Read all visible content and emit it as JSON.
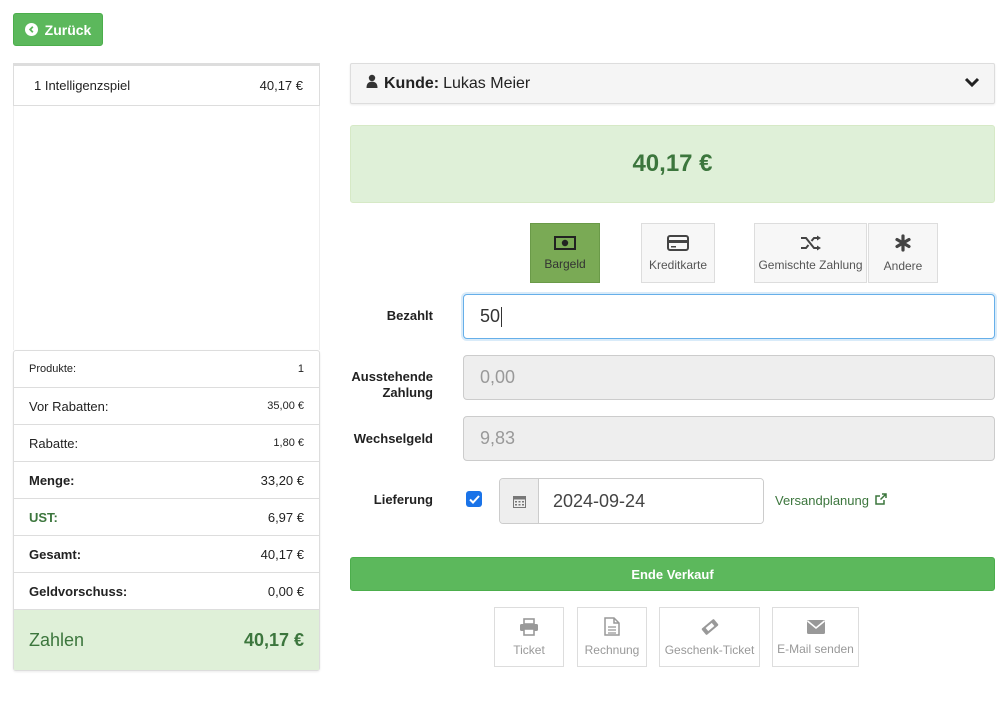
{
  "back": {
    "label": "Zurück"
  },
  "cart": {
    "items": [
      {
        "label": "1 Intelligenzspiel",
        "price": "40,17 €"
      }
    ]
  },
  "totals": {
    "produkte": {
      "label": "Produkte:",
      "value": "1"
    },
    "vor_rabatten": {
      "label": "Vor Rabatten:",
      "value": "35,00 €"
    },
    "rabatte": {
      "label": "Rabatte:",
      "value": "1,80 €"
    },
    "menge": {
      "label": "Menge:",
      "value": "33,20 €"
    },
    "ust": {
      "label": "UST:",
      "value": "6,97 €"
    },
    "gesamt": {
      "label": "Gesamt:",
      "value": "40,17 €"
    },
    "geldvorschuss": {
      "label": "Geldvorschuss:",
      "value": "0,00 €"
    },
    "zahlen": {
      "label": "Zahlen",
      "value": "40,17 €"
    }
  },
  "customer": {
    "key": "Kunde:",
    "name": "Lukas Meier"
  },
  "amount": "40,17 €",
  "methods": [
    {
      "label": "Bargeld",
      "icon": "money-icon",
      "active": true
    },
    {
      "label": "Kreditkarte",
      "icon": "credit-card-icon",
      "active": false
    },
    {
      "label": "Gemischte Zahlung",
      "icon": "shuffle-icon",
      "active": false
    },
    {
      "label": "Andere",
      "icon": "asterisk-icon",
      "active": false
    }
  ],
  "form": {
    "paid_label": "Bezahlt",
    "paid_value": "50",
    "outstanding_label": "Ausstehende Zahlung",
    "outstanding_value": "0,00",
    "change_label": "Wechselgeld",
    "change_value": "9,83",
    "delivery_label": "Lieferung",
    "delivery_checked": true,
    "delivery_date": "2024-09-24",
    "ship_link": "Versandplanung"
  },
  "end_button": "Ende Verkauf",
  "docs": [
    {
      "label": "Ticket",
      "icon": "print-icon"
    },
    {
      "label": "Rechnung",
      "icon": "document-icon"
    },
    {
      "label": "Geschenk-Ticket",
      "icon": "ticket-icon"
    },
    {
      "label": "E-Mail senden",
      "icon": "envelope-icon"
    }
  ],
  "colors": {
    "success": "#5cb85c",
    "success_bg": "#dff0d8",
    "success_text": "#3c763d",
    "active_method": "#7aaa55"
  }
}
